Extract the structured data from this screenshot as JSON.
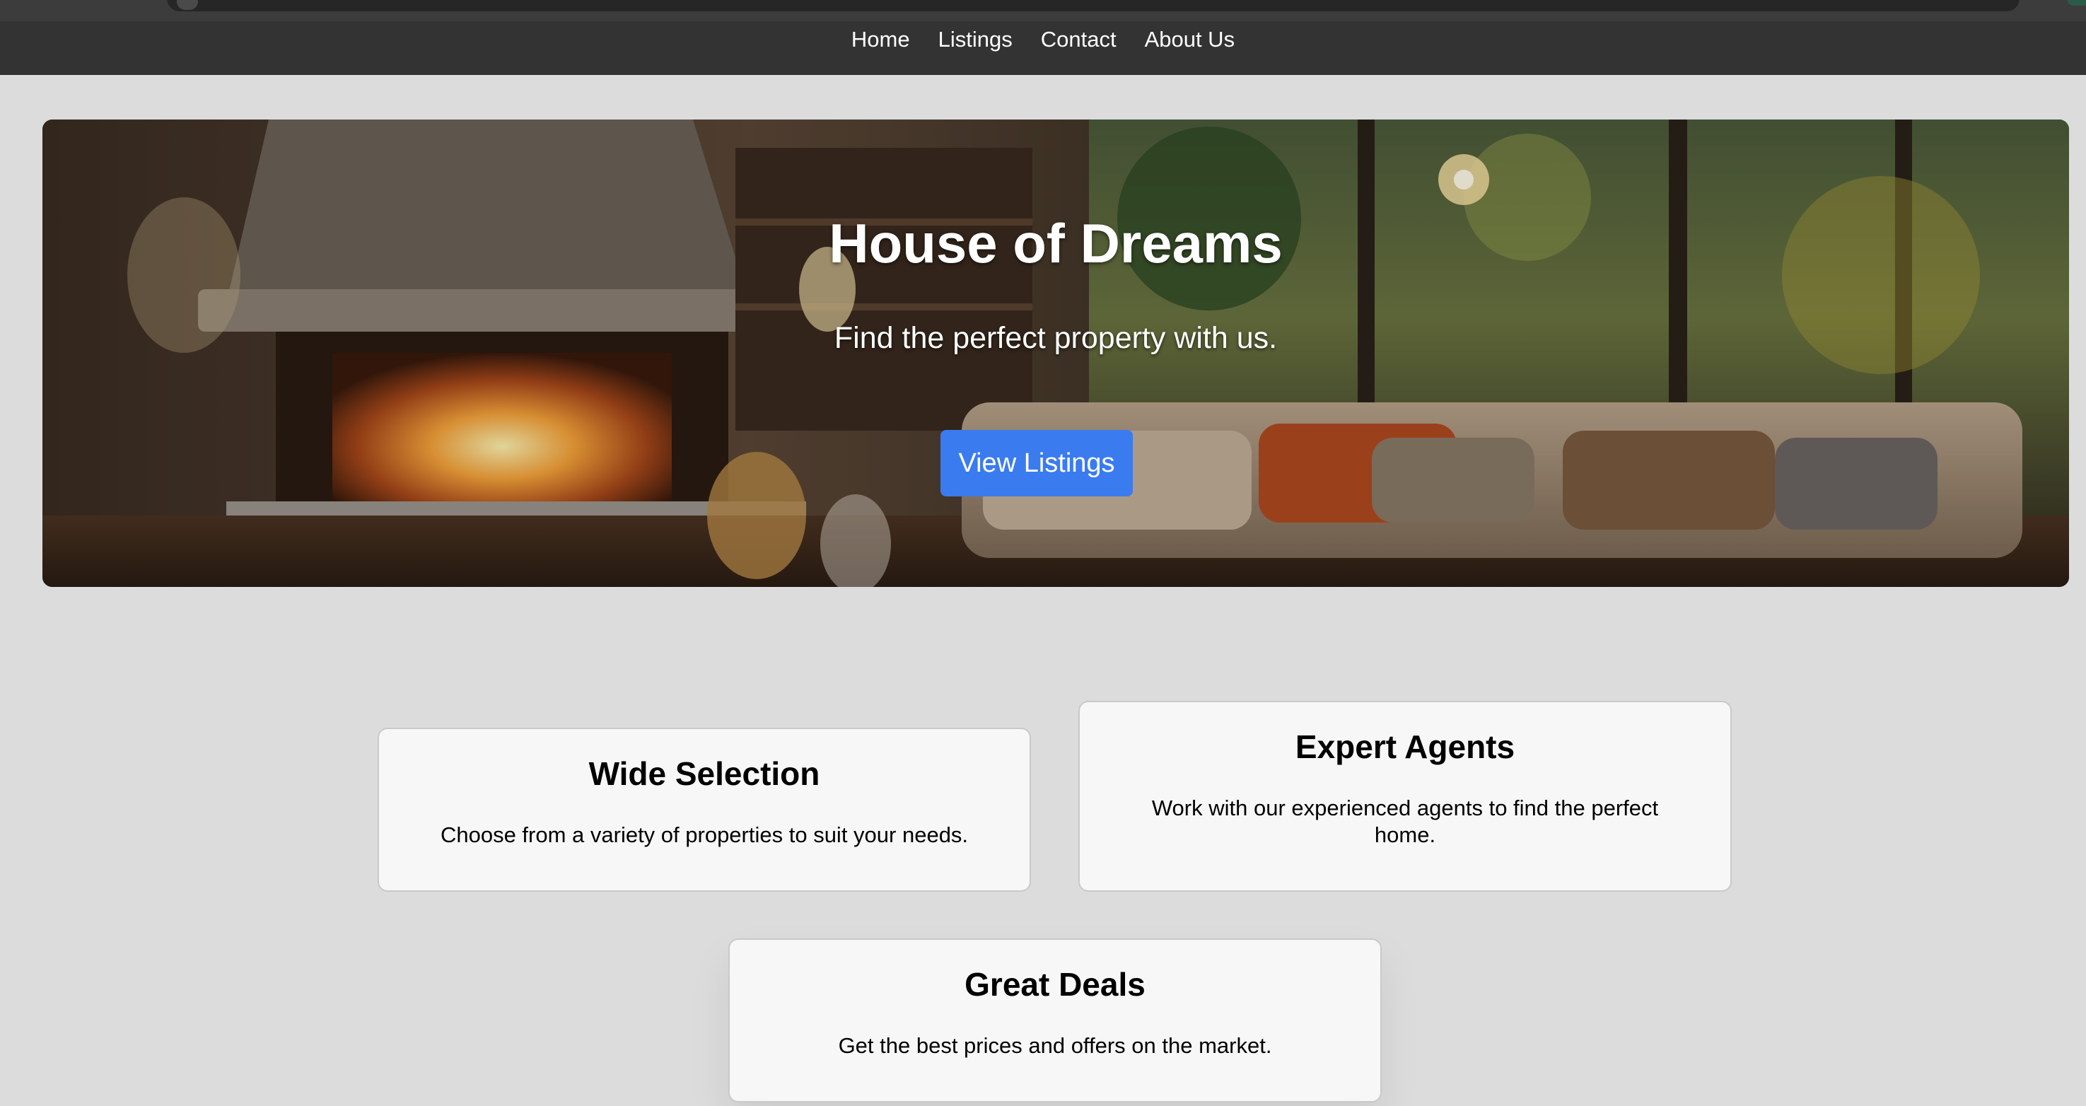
{
  "nav": {
    "items": [
      {
        "label": "Home"
      },
      {
        "label": "Listings"
      },
      {
        "label": "Contact"
      },
      {
        "label": "About Us"
      }
    ]
  },
  "hero": {
    "title": "House of Dreams",
    "subtitle": "Find the perfect property with us.",
    "button_label": "View Listings",
    "image_icon": "living-room-hero-image"
  },
  "features": [
    {
      "title": "Wide Selection",
      "text": "Choose from a variety of properties to suit your needs."
    },
    {
      "title": "Expert Agents",
      "text": "Work with our experienced agents to find the perfect home."
    },
    {
      "title": "Great Deals",
      "text": "Get the best prices and offers on the market."
    }
  ],
  "colors": {
    "nav_bg": "#333333",
    "page_bg": "#dcdcdc",
    "button_bg": "#3a7bf0",
    "card_bg": "#f7f7f7"
  }
}
